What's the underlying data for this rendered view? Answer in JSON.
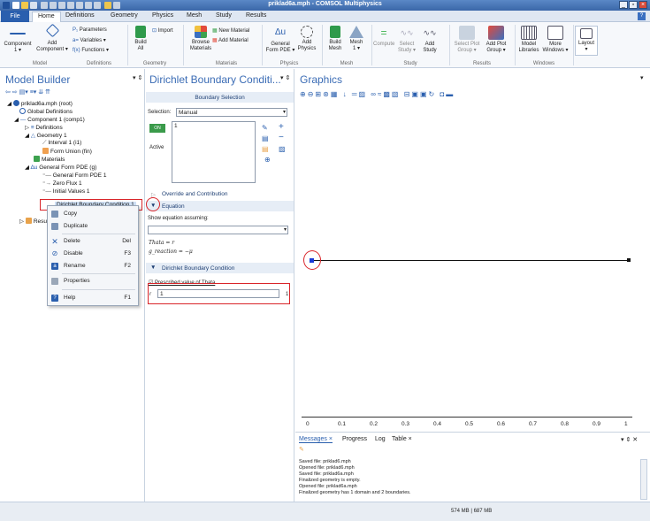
{
  "window": {
    "title": "priklad6a.mph - COMSOL Multiphysics"
  },
  "menu_tabs": [
    "File",
    "Home",
    "Definitions",
    "Geometry",
    "Physics",
    "Mesh",
    "Study",
    "Results"
  ],
  "ribbon": {
    "component_label": "Component\n1 ▾",
    "add_component_label": "Add\nComponent ▾",
    "parameters": "Parameters",
    "variables": "Variables ▾",
    "functions": "Functions ▾",
    "import": "Import",
    "build_all": "Build\nAll",
    "browse_materials": "Browse\nMaterials",
    "new_material": "New Material",
    "add_material": "Add Material",
    "general_form_pde": "General\nForm PDE ▾",
    "add_physics": "Add\nPhysics",
    "build_mesh": "Build\nMesh",
    "mesh1": "Mesh\n1 ▾",
    "compute": "Compute",
    "select_study": "Select\nStudy ▾",
    "add_study": "Add\nStudy",
    "select_plot_group": "Select Plot\nGroup ▾",
    "add_plot_group": "Add Plot\nGroup ▾",
    "model_libraries": "Model\nLibraries",
    "more_windows": "More\nWindows ▾",
    "layout": "Layout\n▾",
    "groups": [
      "Model",
      "Definitions",
      "Geometry",
      "Materials",
      "Physics",
      "Mesh",
      "Study",
      "Results",
      "Windows"
    ]
  },
  "model_builder": {
    "title": "Model Builder",
    "tree": [
      "priklad6a.mph (root)",
      "Global Definitions",
      "Component 1 (comp1)",
      "Definitions",
      "Geometry 1",
      "Interval 1 (i1)",
      "Form Union (fin)",
      "Materials",
      "General Form PDE (g)",
      "General Form PDE 1",
      "Zero Flux 1",
      "Initial Values 1",
      "Dirichlet Boundary Condition 1",
      "Results"
    ]
  },
  "context_menu": [
    {
      "label": "Copy",
      "shortcut": ""
    },
    {
      "label": "Duplicate",
      "shortcut": ""
    },
    {
      "label": "Delete",
      "shortcut": "Del"
    },
    {
      "label": "Disable",
      "shortcut": "F3"
    },
    {
      "label": "Rename",
      "shortcut": "F2"
    },
    {
      "label": "Properties",
      "shortcut": ""
    },
    {
      "label": "Help",
      "shortcut": "F1"
    }
  ],
  "settings": {
    "title": "Dirichlet Boundary Conditi...",
    "boundary_selection": "Boundary Selection",
    "selection_label": "Selection:",
    "selection_value": "Manual",
    "selection_item": "1",
    "active_label": "Active",
    "override": "Override and Contribution",
    "equation": "Equation",
    "show_eq": "Show equation assuming:",
    "eq1": "Thata = r",
    "eq2": "g_reaction = −μ",
    "dbc": "Dirichlet Boundary Condition",
    "prescribed": "Prescribed value of Thata",
    "r_label": "r",
    "r_value": "1",
    "r_unit": "1"
  },
  "graphics": {
    "title": "Graphics",
    "ticks": [
      "0",
      "0.1",
      "0.2",
      "0.3",
      "0.4",
      "0.5",
      "0.6",
      "0.7",
      "0.8",
      "0.9",
      "1"
    ]
  },
  "messages": {
    "tabs": [
      "Messages ×",
      "Progress",
      "Log",
      "Table ×"
    ],
    "lines": [
      "Saved file: priklad6.mph",
      "Opened file: priklad6.mph",
      "Saved file: priklad6a.mph",
      "Finalized geometry is empty.",
      "Opened file: priklad6a.mph",
      "Finalized geometry has 1 domain and 2 boundaries."
    ]
  },
  "status": {
    "memory": "574 MB | 687 MB"
  }
}
